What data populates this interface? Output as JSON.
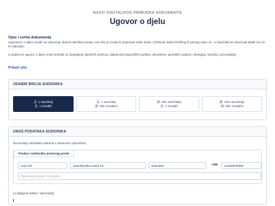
{
  "header": {
    "kicker": "NAZIV DIGITALNOG PRIMJERA DOKUMENTA",
    "title": "Ugovor o djelu"
  },
  "intro": {
    "heading": "Opis i svrha dokumenta",
    "p1": "Ugovorom o djelu uvodić se obvezuje obaviti određeni posao, kao što je izrada ili popravak neke stvari, izvršenje kakva fizičkog ili umnog rada i sl., a naručitelj se obvezuje platiti mu za to naknadu.",
    "p2": "U praksi se ugovor o djelu može koristiti za obavljanje sljedećih poslova: djelatnosti trgovačkih putnika, akviziterа, sportskih sudaca i delegata, tumača, prevoditelja,",
    "show_more": "Prikaži više"
  },
  "participants": {
    "heading": "ODABIR BROJA SUDIONIKA",
    "options": [
      {
        "line1": "1 naručitelj",
        "line2": "1 izvođač",
        "selected": true
      },
      {
        "line1": "1 naručitelj",
        "line2": "više izvođača",
        "selected": false
      },
      {
        "line1": "više naručitelja",
        "line2": "1 izvođač",
        "selected": false
      },
      {
        "line1": "više naručitelja",
        "line2": "više izvođača",
        "selected": false
      }
    ]
  },
  "entry": {
    "heading": "UNOS PODATAKA SUDIONIKA",
    "note": "Na temelju odredaba Zakona o obveznim odnosima:",
    "subtab": "Podaci sudionika pravnog posla",
    "name_value": "Ivan Ivić",
    "address_value": "Samoborska cesta 10",
    "city_value": "Samobor",
    "oib_label": "OIB",
    "oib_value": "12345678900",
    "optional_placeholder": "Opcionalni podaci za osobu...",
    "tail": "(u daljnjem tekstu: Naručitelj)"
  },
  "colors": {
    "selected_bg": "#18284a",
    "link": "#2a5db0",
    "border": "#d7dde6"
  }
}
